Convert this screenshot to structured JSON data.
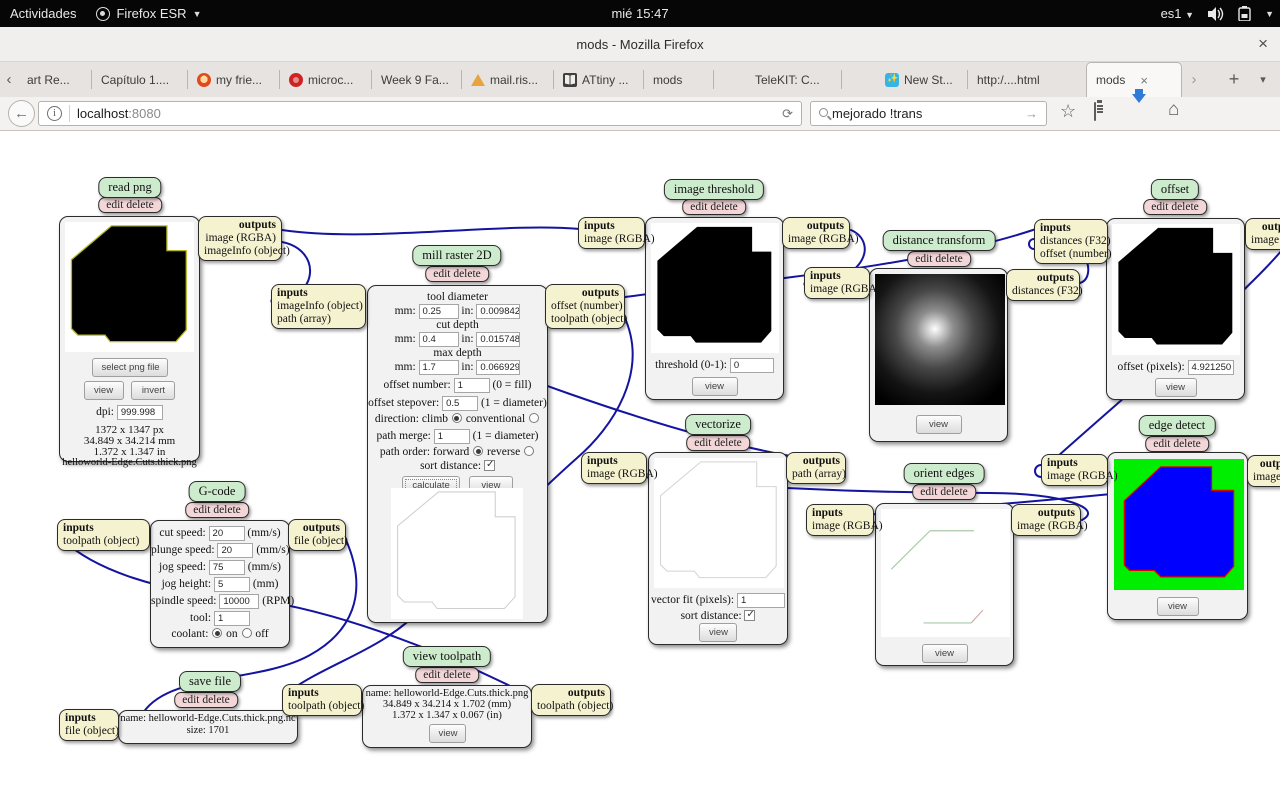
{
  "system_bar": {
    "activities": "Actividades",
    "app_menu": "Firefox ESR",
    "clock": "mié 15:47",
    "lang": "es1"
  },
  "titlebar": {
    "title": "mods - Mozilla Firefox",
    "close": "×"
  },
  "tabbar": {
    "scroll_left": "‹",
    "scroll_right": "›",
    "new_tab": "+",
    "list_tabs": "▾",
    "close_tab": "×",
    "tabs": [
      {
        "label": "art Re..."
      },
      {
        "label": "Capítulo 1...."
      },
      {
        "label": "my frie...",
        "icon": "friend-icon"
      },
      {
        "label": "microc...",
        "icon": "microchip-icon"
      },
      {
        "label": "Week 9 Fa..."
      },
      {
        "label": "mail.ris...",
        "icon": "warning-icon"
      },
      {
        "label": "ATtiny ...",
        "icon": "book-icon"
      },
      {
        "label": "mods"
      },
      {
        "label": "TeleKIT: C..."
      },
      {
        "label": "New St...",
        "icon": "newstar-icon"
      },
      {
        "label": "http:/....html"
      },
      {
        "label": "mods",
        "active": true
      }
    ]
  },
  "navbar": {
    "url_host": "localhost",
    "url_port": ":8080",
    "info_glyph": "i",
    "reload_glyph": "⟳",
    "back_glyph": "←",
    "search_value": "mejorado !trans",
    "search_go": "→"
  },
  "common": {
    "inputs": "inputs",
    "outputs": "outputs",
    "edit_delete": "edit delete",
    "view": "view"
  },
  "colors": {
    "wire": "#1414a0",
    "module_label_bg": "#cdeccd",
    "edit_delete_bg": "#f2d6d8",
    "port_bg": "#f5f2cf",
    "edge_detect_green": "#00ee00",
    "edge_detect_blue": "#0000ff",
    "download_arrow": "#2f7cd8",
    "png_outline_yellow": "#b5b520"
  },
  "modules": {
    "read_png": {
      "title": "read png",
      "outputs_lines": [
        "image (RGBA)",
        "imageInfo (object)"
      ],
      "select_btn": "select png file",
      "view_btn": "view",
      "invert_btn": "invert",
      "dpi_label": "dpi:",
      "dpi_value": "999.998",
      "info": [
        "1372 x 1347 px",
        "34.849 x 34.214 mm",
        "1.372 x 1.347 in",
        "helloworld-Edge.Cuts.thick.png"
      ]
    },
    "mill_raster": {
      "title": "mill raster 2D",
      "inputs_lines": [
        "imageInfo (object)",
        "path (array)"
      ],
      "outputs_lines": [
        "offset (number)",
        "toolpath (object)"
      ],
      "mm_label": "mm:",
      "in_label": "in:",
      "sections": [
        {
          "header": "tool diameter",
          "mm": "0.25",
          "in": "0.0098425"
        },
        {
          "header": "cut depth",
          "mm": "0.4",
          "in": "0.0157480"
        },
        {
          "header": "max depth",
          "mm": "1.7",
          "in": "0.0669291"
        }
      ],
      "offset_number_label": "offset number:",
      "offset_number": "1",
      "offset_number_hint": "(0 = fill)",
      "offset_stepover_label": "offset stepover:",
      "offset_stepover": "0.5",
      "offset_stepover_hint": "(1 = diameter)",
      "direction_label": "direction:",
      "direction_opt1": "climb",
      "direction_opt2": "conventional",
      "path_merge_label": "path merge:",
      "path_merge": "1",
      "path_merge_hint": "(1 = diameter)",
      "path_order_label": "path order:",
      "path_order_opt1": "forward",
      "path_order_opt2": "reverse",
      "sort_label": "sort distance:",
      "calculate_btn": "calculate",
      "view_btn": "view"
    },
    "image_threshold": {
      "title": "image threshold",
      "inputs_lines": [
        "image (RGBA)"
      ],
      "outputs_lines": [
        "image (RGBA)"
      ],
      "threshold_label": "threshold (0-1):",
      "threshold_value": "0"
    },
    "distance_transform": {
      "title": "distance transform",
      "inputs_lines": [
        "image (RGBA)"
      ],
      "outputs_lines": [
        "distances (F32)"
      ]
    },
    "offset": {
      "title": "offset",
      "inputs_lines": [
        "distances (F32)",
        "offset (number)"
      ],
      "outputs_lines": [
        "image (RGBA)"
      ],
      "offset_label": "offset (pixels):",
      "offset_value": "4.921250"
    },
    "vectorize": {
      "title": "vectorize",
      "inputs_lines": [
        "image (RGBA)"
      ],
      "outputs_lines": [
        "path (array)"
      ],
      "fit_label": "vector fit (pixels):",
      "fit_value": "1",
      "sort_label": "sort distance:"
    },
    "orient_edges": {
      "title": "orient edges",
      "inputs_lines": [
        "image (RGBA)"
      ],
      "outputs_lines": [
        "image (RGBA)"
      ]
    },
    "edge_detect": {
      "title": "edge detect",
      "inputs_lines": [
        "image (RGBA)"
      ],
      "outputs_lines": [
        "image (RGBA)"
      ]
    },
    "gcode": {
      "title": "G-code",
      "inputs_lines": [
        "toolpath (object)"
      ],
      "outputs_lines": [
        "file (object)"
      ],
      "rows": [
        {
          "label": "cut speed:",
          "value": "20",
          "unit": "(mm/s)"
        },
        {
          "label": "plunge speed:",
          "value": "20",
          "unit": "(mm/s)"
        },
        {
          "label": "jog speed:",
          "value": "75",
          "unit": "(mm/s)"
        },
        {
          "label": "jog height:",
          "value": "5",
          "unit": "(mm)"
        },
        {
          "label": "spindle speed:",
          "value": "10000",
          "unit": "(RPM)"
        },
        {
          "label": "tool:",
          "value": "1",
          "unit": ""
        }
      ],
      "coolant_label": "coolant:",
      "coolant_on": "on",
      "coolant_off": "off"
    },
    "save_file": {
      "title": "save file",
      "inputs_lines": [
        "file (object)"
      ],
      "name_line": "name: helloworld-Edge.Cuts.thick.png.nc",
      "size_line": "size: 1701"
    },
    "view_toolpath": {
      "title": "view toolpath",
      "inputs_lines": [
        "toolpath (object)"
      ],
      "outputs_lines": [
        "toolpath (object)"
      ],
      "lines": [
        "name: helloworld-Edge.Cuts.thick.png",
        "34.849 x 34.214 x 1.702 (mm)",
        "1.372 x 1.347 x 0.067 (in)"
      ]
    }
  }
}
